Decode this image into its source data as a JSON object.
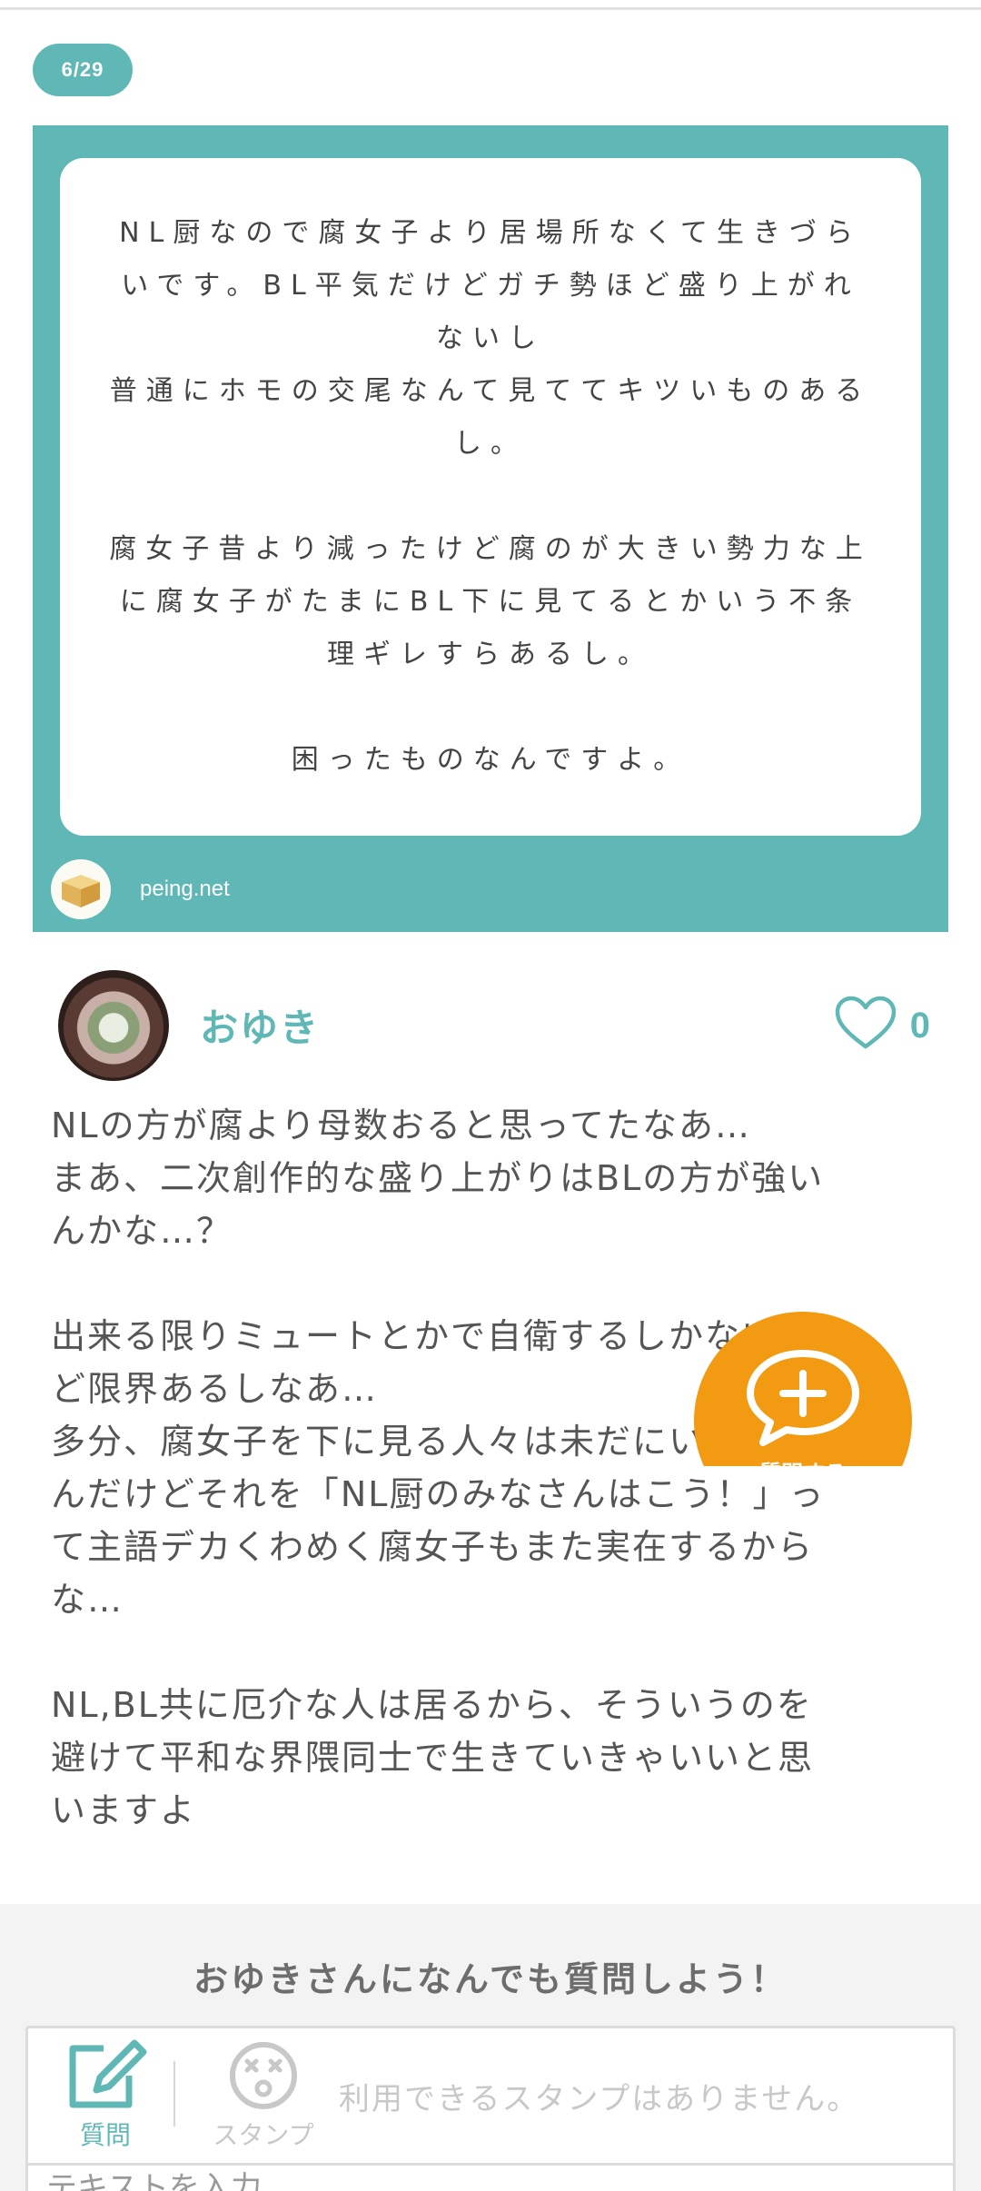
{
  "counter": "6/29",
  "question": {
    "paragraphs": [
      "NL厨なので腐女子より居場所なくて生きづら\nいです。BL平気だけどガチ勢ほど盛り上がれ\nないし\n普通にホモの交尾なんて見ててキツいものある\nし。",
      "腐女子昔より減ったけど腐のが大きい勢力な上\nに腐女子がたまにBL下に見てるとかいう不条\n理ギレすらあるし。",
      "困ったものなんですよ。"
    ],
    "footer_site": "peing.net"
  },
  "answer": {
    "user_name": "おゆき",
    "like_count": "0",
    "paragraphs": [
      "NLの方が腐より母数おると思ってたなあ…\nまあ、二次創作的な盛り上がりはBLの方が強い\nんかな…？",
      "出来る限りミュートとかで自衛するしかないけ\nど限界あるしなあ…\n多分、腐女子を下に見る人々は未だにいると思う\nんだけどそれを「NL厨のみなさんはこう！」っ\nて主語デカくわめく腐女子もまた実在するから\nな…",
      "NL,BL共に厄介な人は居るから、そういうのを\n避けて平和な界隈同士で生きていきゃいいと思\nいますよ"
    ]
  },
  "fab": {
    "label": "質問する"
  },
  "ask_form": {
    "title": "おゆきさんになんでも質問しよう！",
    "question_tool_label": "質問",
    "stamp_tool_label": "スタンプ",
    "stamp_empty_message": "利用できるスタンプはありません。",
    "input_placeholder": "テキストを入力"
  },
  "colors": {
    "accent": "#5fb8b6",
    "fab": "#f29a12",
    "section_bg": "#f3f3f3",
    "muted": "#c8c8c8"
  },
  "icons": {
    "like": "heart-outline-icon",
    "fab": "speech-bubble-plus-icon",
    "question_tool": "pencil-square-icon",
    "stamp_tool": "dizzy-face-icon",
    "peing_logo": "box-logo"
  }
}
